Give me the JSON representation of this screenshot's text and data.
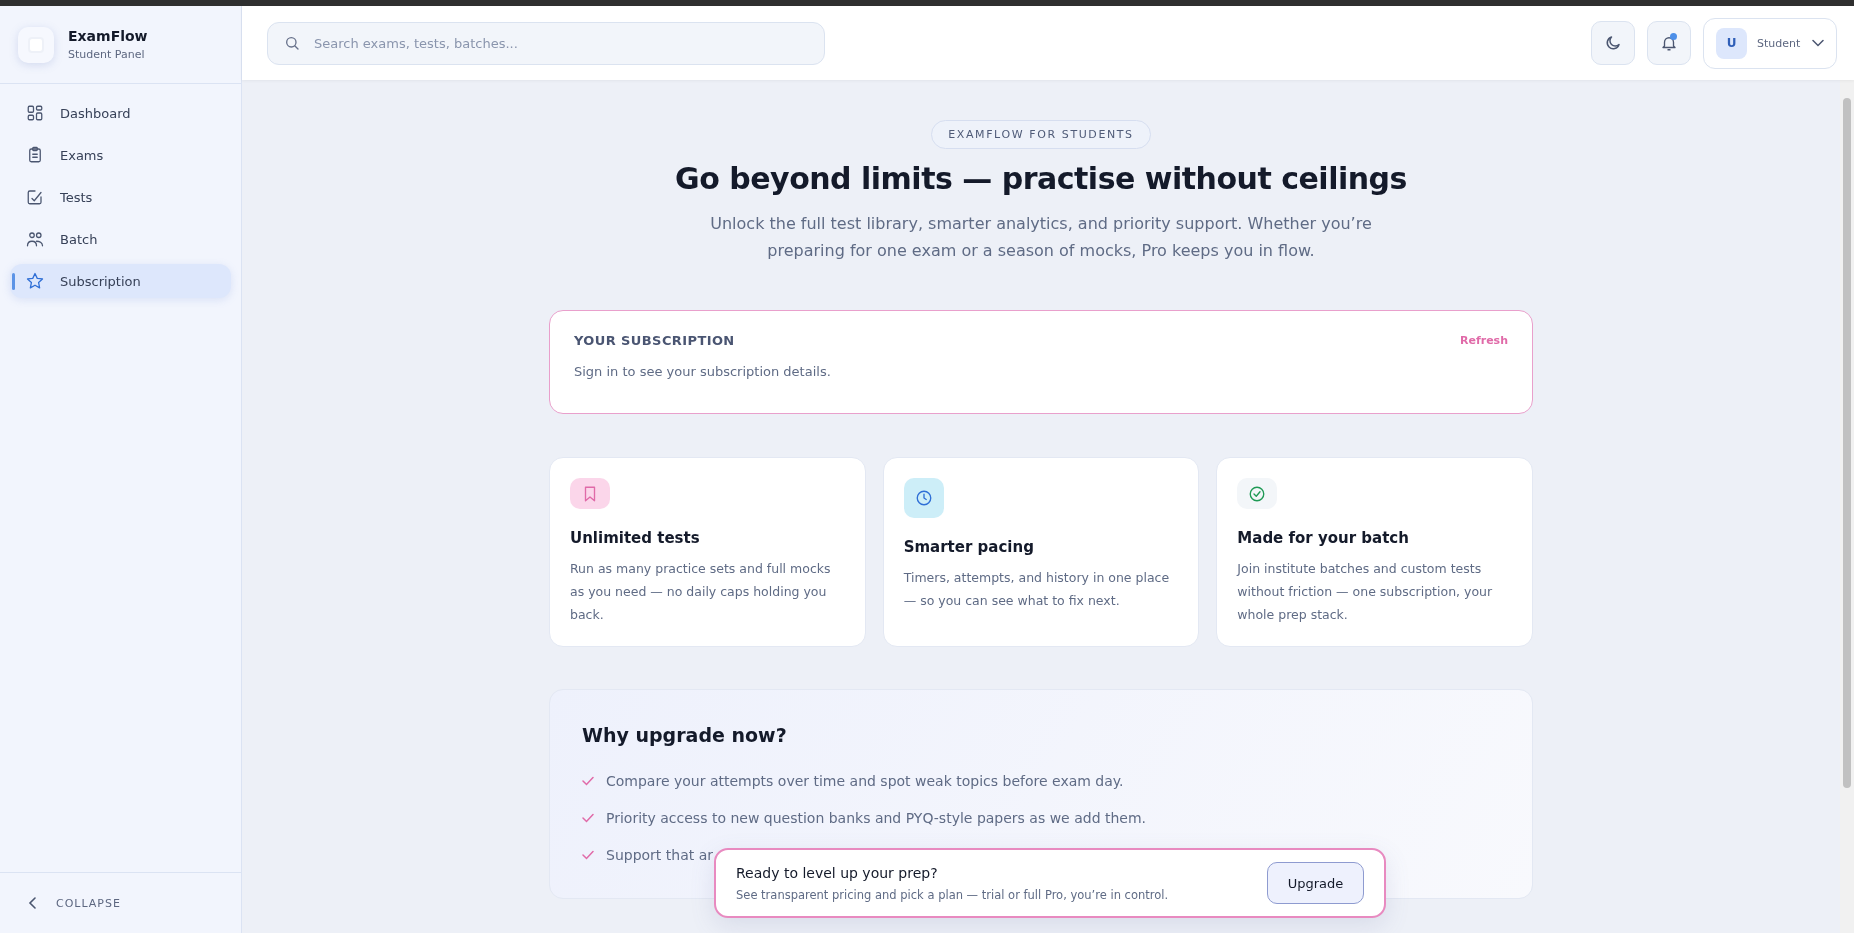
{
  "app": {
    "name": "ExamFlow",
    "subtitle": "Student Panel"
  },
  "sidebar": {
    "items": [
      {
        "label": "Dashboard",
        "kind": "dashboard",
        "selected": false
      },
      {
        "label": "Exams",
        "kind": "clipboard",
        "selected": false
      },
      {
        "label": "Tests",
        "kind": "edit",
        "selected": false
      },
      {
        "label": "Batch",
        "kind": "users",
        "selected": false
      },
      {
        "label": "Subscription",
        "kind": "star",
        "selected": true
      }
    ],
    "collapse": "COLLAPSE"
  },
  "header": {
    "search": {
      "placeholder": "Search exams, tests, batches..."
    },
    "notifications_unread": true,
    "user": {
      "initial": "U",
      "role": "Student"
    }
  },
  "hero": {
    "badge": "EXAMFLOW FOR STUDENTS",
    "title": "Go beyond limits — practise without ceilings",
    "subtitle": "Unlock the full test library, smarter analytics, and priority support. Whether you’re preparing for one exam or a season of mocks, Pro keeps you in flow."
  },
  "subscription": {
    "heading": "YOUR SUBSCRIPTION",
    "action": "Refresh",
    "message": "Sign in to see your subscription details."
  },
  "features": [
    {
      "kind": "bookmark",
      "title": "Unlimited tests",
      "text": "Run as many practice sets and full mocks as you need — no daily caps holding you back."
    },
    {
      "kind": "clock",
      "title": "Smarter pacing",
      "text": "Timers, attempts, and history in one place — so you can see what to fix next."
    },
    {
      "kind": "check",
      "title": "Made for your batch",
      "text": "Join institute batches and custom tests without friction — one subscription, your whole prep stack."
    }
  ],
  "why": {
    "title": "Why upgrade now?",
    "points": [
      "Compare your attempts over time and spot weak topics before exam day.",
      "Priority access to new question banks and PYQ-style papers as we add them.",
      "Support that ar"
    ]
  },
  "banner": {
    "title": "Ready to level up your prep?",
    "text": "See transparent pricing and pick a plan — trial or full Pro, you’re in control.",
    "button": "Upgrade"
  }
}
